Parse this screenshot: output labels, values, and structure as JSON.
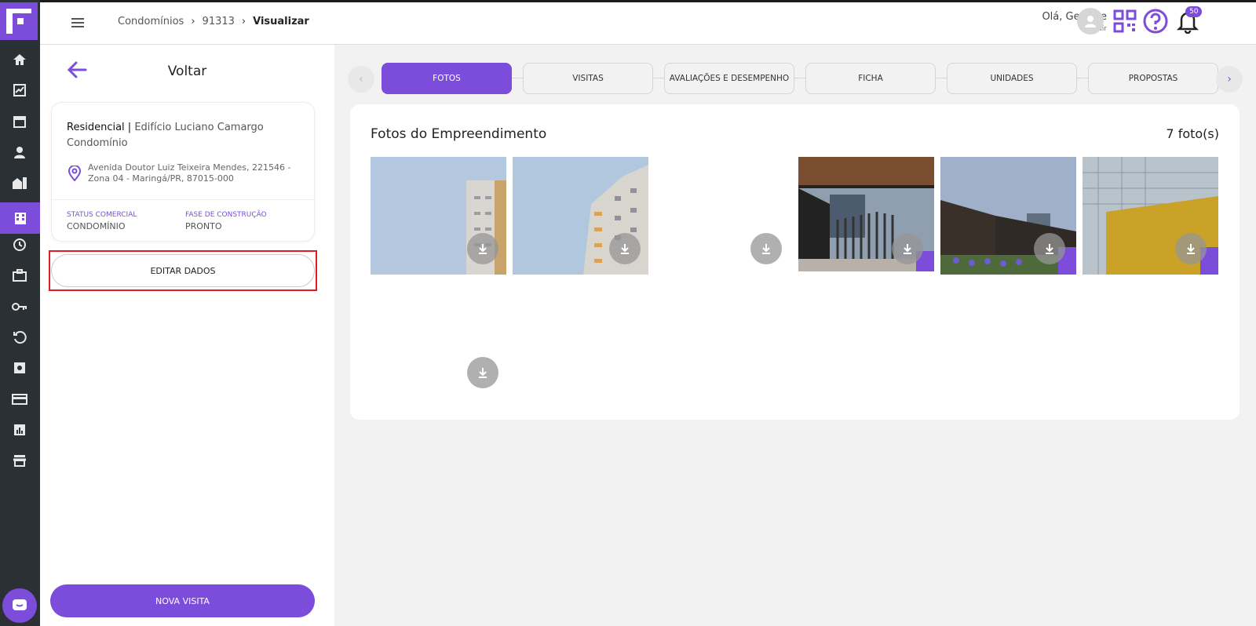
{
  "app": {
    "accent": "#7c4ddb"
  },
  "rail": {
    "icons": [
      "home-icon",
      "chart-icon",
      "calendar-icon",
      "person-icon",
      "building-icon",
      "apartment-icon",
      "clock-icon",
      "briefcase-icon",
      "key-icon",
      "history-icon",
      "gear-box-icon",
      "card-icon",
      "report-icon",
      "store-icon"
    ],
    "active": "apartment-icon"
  },
  "header": {
    "breadcrumb": [
      "Condomínios",
      "91313",
      "Visualizar"
    ],
    "greeting": "Olá, Gerente",
    "logout": "Sair",
    "notifications": "50"
  },
  "left": {
    "back_label": "Voltar",
    "kind": "Residencial",
    "separator": " | ",
    "name": "Edifício Luciano Camargo Condomínio",
    "address": "Avenida Doutor Luiz Teixeira Mendes, 221546 - Zona 04 - Maringá/PR, 87015-000",
    "status_label": "STATUS COMERCIAL",
    "status_value": "CONDOMÍNIO",
    "phase_label": "FASE DE CONSTRUÇÃO",
    "phase_value": "PRONTO",
    "edit_button": "EDITAR DADOS",
    "new_visit_button": "NOVA VISITA"
  },
  "tabs": [
    {
      "label": "FOTOS",
      "active": true
    },
    {
      "label": "VISITAS",
      "active": false
    },
    {
      "label": "AVALIAÇÕES E DESEMPENHO",
      "active": false
    },
    {
      "label": "FICHA",
      "active": false
    },
    {
      "label": "UNIDADES",
      "active": false
    },
    {
      "label": "PROPOSTAS",
      "active": false
    }
  ],
  "photos": {
    "title": "Fotos do Empreendimento",
    "count": "7 foto(s)"
  }
}
